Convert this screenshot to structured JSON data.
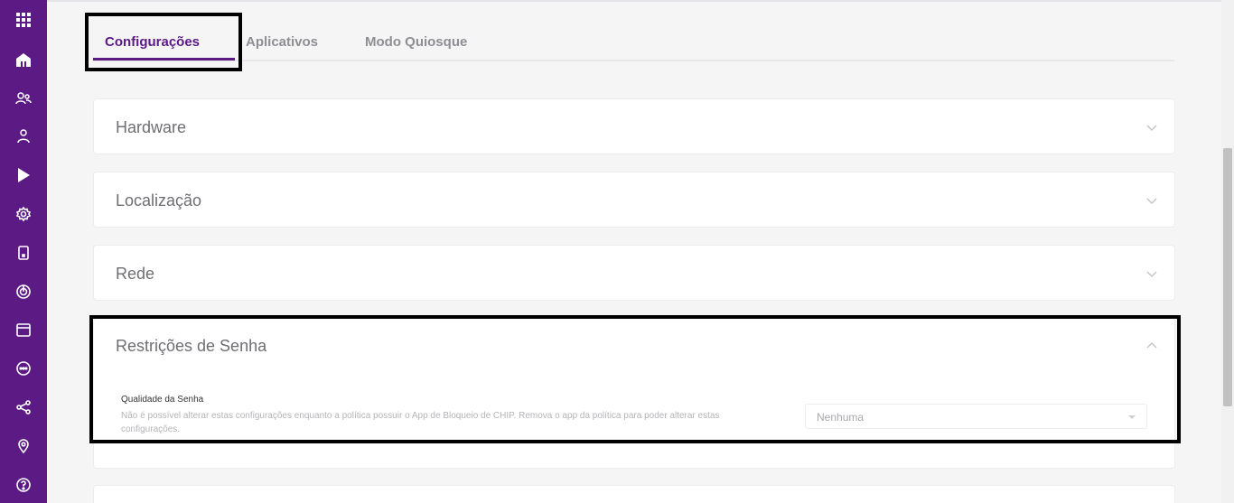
{
  "sidebar": {
    "items": [
      {
        "icon": "apps-grid-icon"
      },
      {
        "icon": "dashboard-icon"
      },
      {
        "icon": "groups-icon"
      },
      {
        "icon": "user-icon"
      },
      {
        "icon": "play-store-icon"
      },
      {
        "icon": "policies-gear-icon"
      },
      {
        "icon": "device-icon"
      },
      {
        "icon": "radar-icon"
      },
      {
        "icon": "calendar-icon"
      },
      {
        "icon": "chat-icon"
      },
      {
        "icon": "share-icon"
      },
      {
        "icon": "location-icon"
      },
      {
        "icon": "help-icon"
      }
    ],
    "color": "#5b1a84"
  },
  "tabs": {
    "items": [
      {
        "label": "Configurações",
        "active": true
      },
      {
        "label": "Aplicativos",
        "active": false
      },
      {
        "label": "Modo Quiosque",
        "active": false
      }
    ],
    "accent": "#5b1a84"
  },
  "panels": [
    {
      "title": "Hardware",
      "expanded": false
    },
    {
      "title": "Localização",
      "expanded": false
    },
    {
      "title": "Rede",
      "expanded": false
    },
    {
      "title": "Restrições de Senha",
      "expanded": true
    }
  ],
  "password_quality": {
    "label": "Qualidade da Senha",
    "description": "Não é possível alterar estas configurações enquanto a política possuir o App de Bloqueio de CHIP. Remova o app da política para poder alterar estas configurações.",
    "select_value": "Nenhuma"
  }
}
